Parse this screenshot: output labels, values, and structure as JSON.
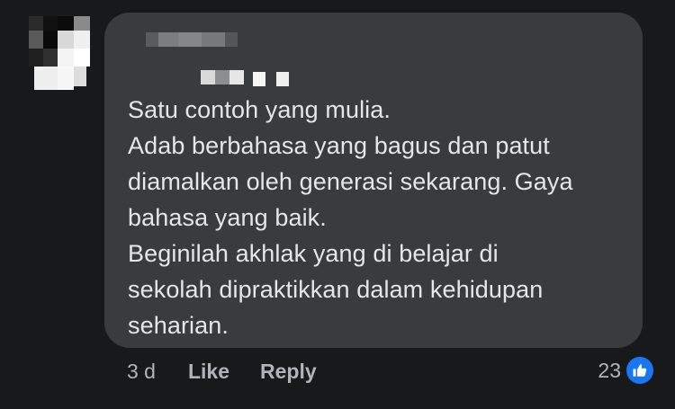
{
  "comment": {
    "author_name_visible": false,
    "lines": [
      "Satu contoh yang mulia.",
      "Adab berbahasa yang bagus dan patut",
      "diamalkan oleh generasi sekarang. Gaya",
      "bahasa yang baik.",
      "Beginilah akhlak yang di belajar di",
      "sekolah dipraktikkan dalam kehidupan",
      "seharian."
    ]
  },
  "actions": {
    "timestamp": "3 d",
    "like_label": "Like",
    "reply_label": "Reply"
  },
  "reactions": {
    "count": "23",
    "icon": "like-thumb-icon",
    "badge_color": "#1877f2"
  },
  "theme": {
    "background": "#18191a",
    "bubble": "#3a3b3c",
    "text": "#e4e6eb",
    "secondary_text": "#b0b3b8"
  }
}
